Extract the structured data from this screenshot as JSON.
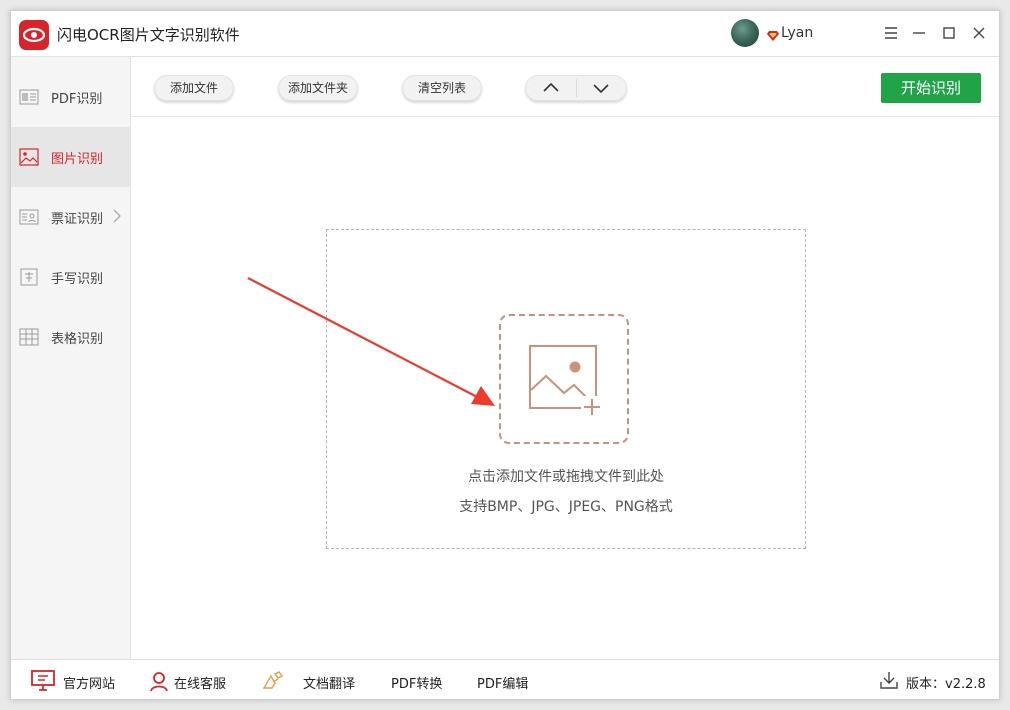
{
  "app": {
    "title": "闪电OCR图片文字识别软件"
  },
  "user": {
    "name": "Lyan"
  },
  "sidebar": {
    "items": [
      {
        "label": "PDF识别"
      },
      {
        "label": "图片识别"
      },
      {
        "label": "票证识别"
      },
      {
        "label": "手写识别"
      },
      {
        "label": "表格识别"
      }
    ]
  },
  "toolbar": {
    "add_file": "添加文件",
    "add_folder": "添加文件夹",
    "clear_list": "清空列表",
    "start": "开始识别"
  },
  "dropzone": {
    "hint": "点击添加文件或拖拽文件到此处",
    "formats": "支持BMP、JPG、JPEG、PNG格式"
  },
  "footer": {
    "website": "官方网站",
    "service": "在线客服",
    "translate": "文档翻译",
    "pdf_convert": "PDF转换",
    "pdf_edit": "PDF编辑",
    "version": "版本：v2.2.8"
  },
  "colors": {
    "accent": "#d7242a",
    "start_button": "#21a348",
    "drop_icon": "#c8927c"
  }
}
